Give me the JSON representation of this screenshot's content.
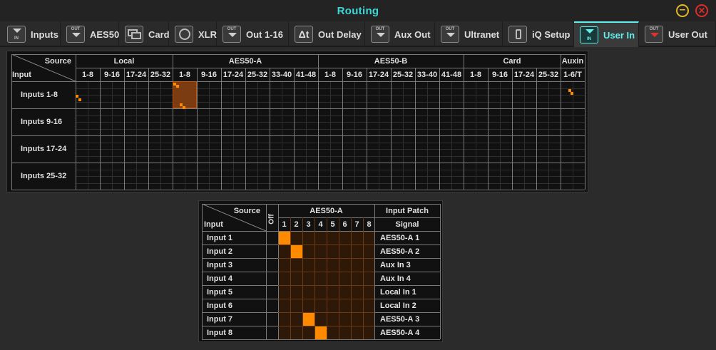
{
  "window": {
    "title": "Routing"
  },
  "tabs": [
    {
      "label": "Inputs",
      "icon": "in-icon"
    },
    {
      "label": "AES50",
      "icon": "out-icon"
    },
    {
      "label": "Card",
      "icon": "card-icon"
    },
    {
      "label": "XLR",
      "icon": "xlr-icon"
    },
    {
      "label": "Out 1-16",
      "icon": "out-icon"
    },
    {
      "label": "Out Delay",
      "icon": "delay-icon"
    },
    {
      "label": "Aux Out",
      "icon": "out-icon"
    },
    {
      "label": "Ultranet",
      "icon": "out-icon"
    },
    {
      "label": "iQ Setup",
      "icon": "iq-icon"
    },
    {
      "label": "User In",
      "icon": "in-icon"
    },
    {
      "label": "User Out",
      "icon": "out-icon"
    }
  ],
  "active_tab": "User In",
  "icon_text": {
    "in": "IN",
    "out": "OUT",
    "delay": "Δt"
  },
  "overview": {
    "corner_source": "Source",
    "corner_input": "Input",
    "groups": [
      {
        "name": "Local",
        "cols": [
          "1-8",
          "9-16",
          "17-24",
          "25-32"
        ]
      },
      {
        "name": "AES50-A",
        "cols": [
          "1-8",
          "9-16",
          "17-24",
          "25-32",
          "33-40",
          "41-48"
        ]
      },
      {
        "name": "AES50-B",
        "cols": [
          "1-8",
          "9-16",
          "17-24",
          "25-32",
          "33-40",
          "41-48"
        ]
      },
      {
        "name": "Card",
        "cols": [
          "1-8",
          "9-16",
          "17-24",
          "25-32"
        ]
      },
      {
        "name": "Auxin",
        "cols": [
          "1-6/T"
        ]
      }
    ],
    "rows": [
      "Inputs 1-8",
      "Inputs 9-16",
      "Inputs 17-24",
      "Inputs 25-32"
    ]
  },
  "detail": {
    "corner_source": "Source",
    "corner_input": "Input",
    "off_label": "Off",
    "group_label": "AES50-A",
    "cols": [
      "1",
      "2",
      "3",
      "4",
      "5",
      "6",
      "7",
      "8"
    ],
    "patch_header": "Input Patch",
    "signal_header": "Signal",
    "rows": [
      {
        "label": "Input 1",
        "signal": "AES50-A 1",
        "active": 1
      },
      {
        "label": "Input 2",
        "signal": "AES50-A 2",
        "active": 2
      },
      {
        "label": "Input 3",
        "signal": "Aux In 3",
        "active": 0
      },
      {
        "label": "Input 4",
        "signal": "Aux In 4",
        "active": 0
      },
      {
        "label": "Input 5",
        "signal": "Local In 1",
        "active": 0
      },
      {
        "label": "Input 6",
        "signal": "Local In 2",
        "active": 0
      },
      {
        "label": "Input 7",
        "signal": "AES50-A 3",
        "active": 3
      },
      {
        "label": "Input 8",
        "signal": "AES50-A 4",
        "active": 4
      }
    ]
  },
  "colors": {
    "accent": "#5ff0f0",
    "patch": "#ff8a00",
    "highlight": "#7a3c10"
  }
}
